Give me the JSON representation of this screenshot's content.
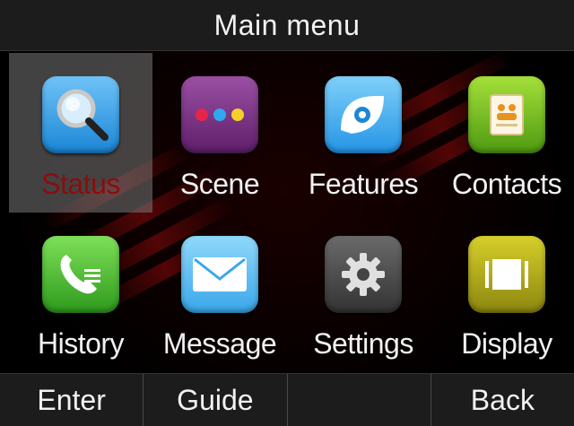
{
  "title": "Main menu",
  "menu_items": [
    {
      "label": "Status",
      "icon": "magnifier-icon",
      "selected": true
    },
    {
      "label": "Scene",
      "icon": "three-dots-icon",
      "selected": false
    },
    {
      "label": "Features",
      "icon": "eye-icon",
      "selected": false
    },
    {
      "label": "Contacts",
      "icon": "address-book-icon",
      "selected": false
    },
    {
      "label": "History",
      "icon": "phone-log-icon",
      "selected": false
    },
    {
      "label": "Message",
      "icon": "envelope-icon",
      "selected": false
    },
    {
      "label": "Settings",
      "icon": "gear-icon",
      "selected": false
    },
    {
      "label": "Display",
      "icon": "display-frame-icon",
      "selected": false
    }
  ],
  "softkeys": [
    "Enter",
    "Guide",
    "",
    "Back"
  ],
  "colors": {
    "selected_label": "#8a0d0d",
    "selected_background": "#787878",
    "bar_background": "#1c1c1c",
    "text": "#f2f2f2"
  }
}
